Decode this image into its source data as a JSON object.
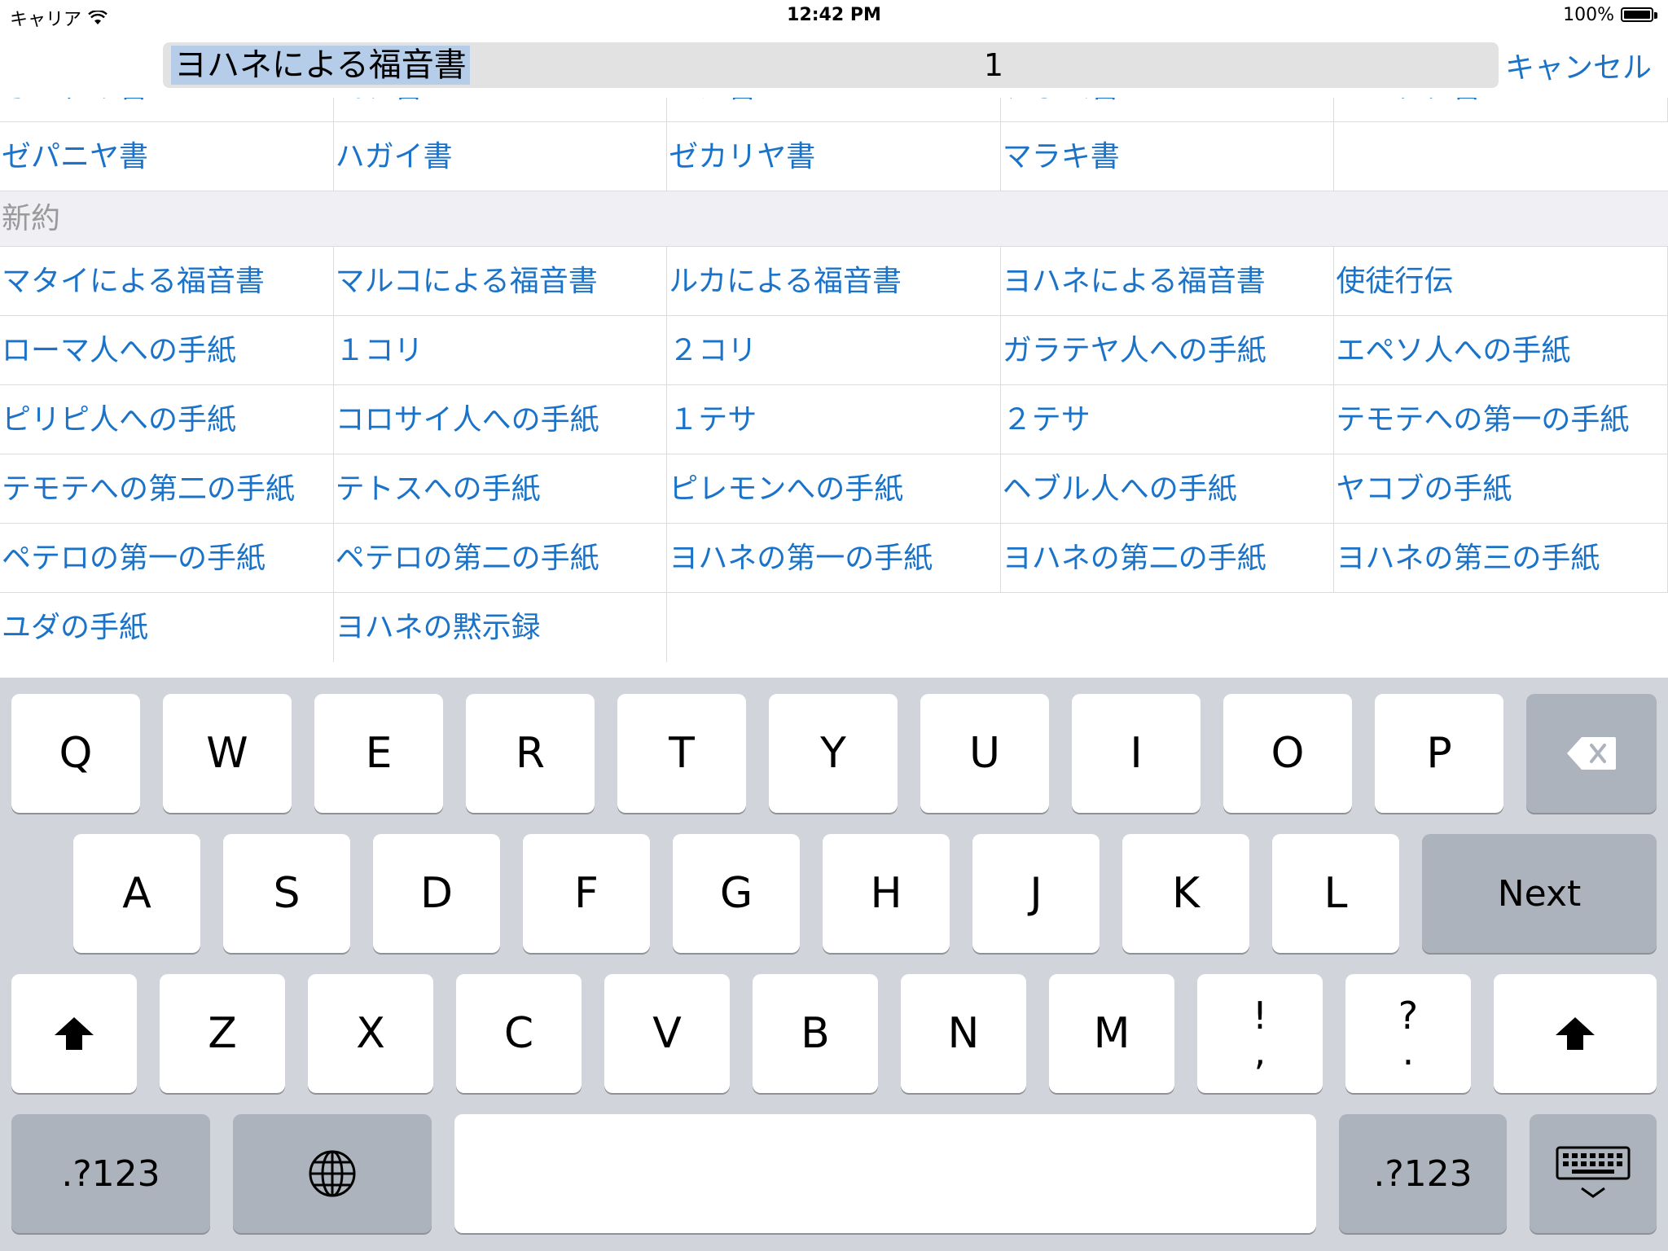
{
  "status_bar": {
    "carrier": "キャリア",
    "time": "12:42 PM",
    "battery": "100%"
  },
  "search": {
    "selected_text": "ヨハネによる福音書",
    "count": "1",
    "cancel_label": "キャンセル"
  },
  "old_testament_partial_row": [
    "オバデヤ書",
    "ヨナ書",
    "ミカ書",
    "ナホム書",
    "ハバクク書"
  ],
  "old_testament_last_row": [
    "ゼパニヤ書",
    "ハガイ書",
    "ゼカリヤ書",
    "マラキ書",
    ""
  ],
  "new_testament": {
    "header": "新約",
    "rows": [
      [
        "マタイによる福音書",
        "マルコによる福音書",
        "ルカによる福音書",
        "ヨハネによる福音書",
        "使徒行伝"
      ],
      [
        "ローマ人への手紙",
        "１コリ",
        "２コリ",
        "ガラテヤ人への手紙",
        "エペソ人への手紙"
      ],
      [
        "ピリピ人への手紙",
        "コロサイ人への手紙",
        "１テサ",
        "２テサ",
        "テモテへの第一の手紙"
      ],
      [
        "テモテへの第二の手紙",
        "テトスへの手紙",
        "ピレモンへの手紙",
        "ヘブル人への手紙",
        "ヤコブの手紙"
      ],
      [
        "ペテロの第一の手紙",
        "ペテロの第二の手紙",
        "ヨハネの第一の手紙",
        "ヨハネの第二の手紙",
        "ヨハネの第三の手紙"
      ],
      [
        "ユダの手紙",
        "ヨハネの黙示録",
        "",
        "",
        ""
      ]
    ]
  },
  "keyboard": {
    "row1": [
      "Q",
      "W",
      "E",
      "R",
      "T",
      "Y",
      "U",
      "I",
      "O",
      "P"
    ],
    "row2": [
      "A",
      "S",
      "D",
      "F",
      "G",
      "H",
      "J",
      "K",
      "L"
    ],
    "row3": [
      "Z",
      "X",
      "C",
      "V",
      "B",
      "N",
      "M"
    ],
    "punct1": [
      "!",
      ","
    ],
    "punct2": [
      "?",
      "."
    ],
    "next_label": "Next",
    "numbers_label": ".?123",
    "icons": {
      "delete": "delete-icon",
      "shift": "shift-icon",
      "globe": "globe-icon",
      "hide": "keyboard-hide-icon"
    }
  },
  "colors": {
    "link": "#1a73c9",
    "keyboard_bg": "#d1d5db",
    "func_key": "#adb3bc",
    "selection": "#b5cde9"
  }
}
